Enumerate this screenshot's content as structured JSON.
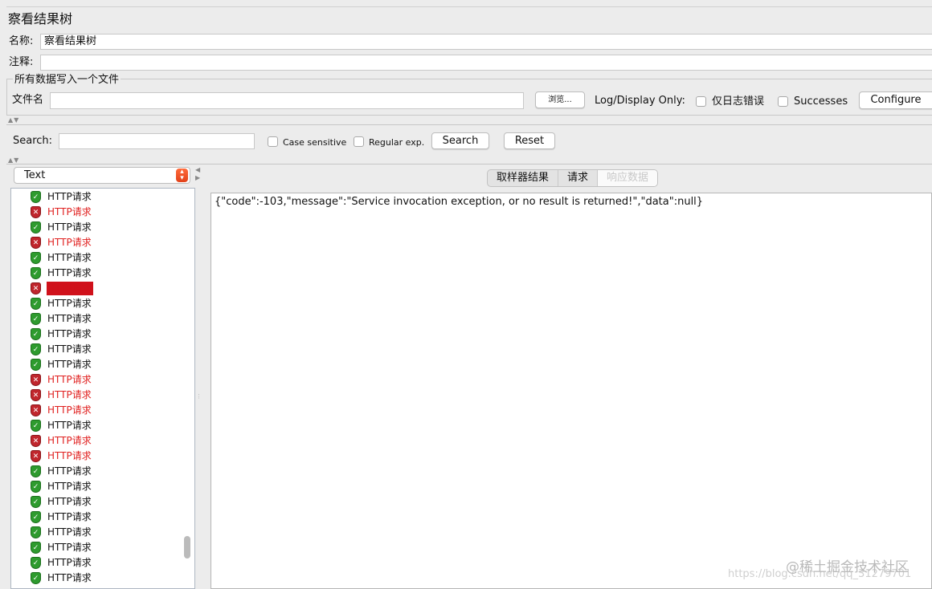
{
  "window": {
    "title": "察看结果树"
  },
  "form": {
    "name_label": "名称:",
    "name_value": "察看结果树",
    "comment_label": "注释:",
    "comment_value": ""
  },
  "file_group": {
    "title": "所有数据写入一个文件",
    "filename_label": "文件名",
    "filename_value": "",
    "browse_label": "浏览...",
    "log_display_label": "Log/Display Only:",
    "errors_only_label": "仅日志错误",
    "successes_label": "Successes",
    "configure_label": "Configure"
  },
  "search": {
    "label": "Search:",
    "value": "",
    "case_sensitive_label": "Case sensitive",
    "regex_label": "Regular exp.",
    "search_button": "Search",
    "reset_button": "Reset"
  },
  "renderer": {
    "selected": "Text"
  },
  "results": {
    "items": [
      {
        "label": "HTTP请求",
        "status": "ok"
      },
      {
        "label": "HTTP请求",
        "status": "fail"
      },
      {
        "label": "HTTP请求",
        "status": "ok"
      },
      {
        "label": "HTTP请求",
        "status": "fail"
      },
      {
        "label": "HTTP请求",
        "status": "ok"
      },
      {
        "label": "HTTP请求",
        "status": "ok"
      },
      {
        "label": "HTTP请求",
        "status": "fail",
        "selected": true
      },
      {
        "label": "HTTP请求",
        "status": "ok"
      },
      {
        "label": "HTTP请求",
        "status": "ok"
      },
      {
        "label": "HTTP请求",
        "status": "ok"
      },
      {
        "label": "HTTP请求",
        "status": "ok"
      },
      {
        "label": "HTTP请求",
        "status": "ok"
      },
      {
        "label": "HTTP请求",
        "status": "fail"
      },
      {
        "label": "HTTP请求",
        "status": "fail"
      },
      {
        "label": "HTTP请求",
        "status": "fail"
      },
      {
        "label": "HTTP请求",
        "status": "ok"
      },
      {
        "label": "HTTP请求",
        "status": "fail"
      },
      {
        "label": "HTTP请求",
        "status": "fail"
      },
      {
        "label": "HTTP请求",
        "status": "ok"
      },
      {
        "label": "HTTP请求",
        "status": "ok"
      },
      {
        "label": "HTTP请求",
        "status": "ok"
      },
      {
        "label": "HTTP请求",
        "status": "ok"
      },
      {
        "label": "HTTP请求",
        "status": "ok"
      },
      {
        "label": "HTTP请求",
        "status": "ok"
      },
      {
        "label": "HTTP请求",
        "status": "ok"
      },
      {
        "label": "HTTP请求",
        "status": "ok"
      }
    ]
  },
  "detail_tabs": [
    {
      "label": "取样器结果",
      "active": false
    },
    {
      "label": "请求",
      "active": false
    },
    {
      "label": "响应数据",
      "active": true
    }
  ],
  "response": {
    "body": "{\"code\":-103,\"message\":\"Service invocation exception, or no result is returned!\",\"data\":null}"
  },
  "watermark": {
    "line1": "@稀土掘金技术社区",
    "line2": "https://blog.csdn.net/qq_31279701"
  },
  "colors": {
    "ok": "#2e9b2e",
    "fail": "#e0201f",
    "selected_bg": "#d0111b"
  },
  "icons": {
    "ok": "shield-check-icon",
    "fail": "shield-x-icon"
  }
}
